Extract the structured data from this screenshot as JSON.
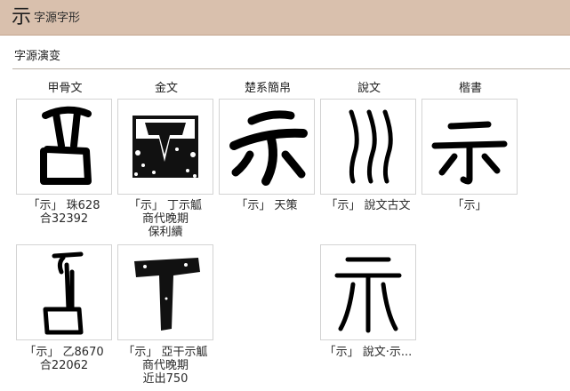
{
  "header": {
    "big_char": "示",
    "title": "字源字形"
  },
  "section": {
    "title": "字源演变"
  },
  "columns": [
    "甲骨文",
    "金文",
    "楚系簡帛",
    "說文",
    "楷書"
  ],
  "glyphs": {
    "jiaguwen_1": {
      "lines": [
        "「示」 珠628",
        "合32392"
      ]
    },
    "jinwen_1": {
      "lines": [
        "「示」 丁示觚",
        "商代晚期",
        "保利續"
      ]
    },
    "chu_1": {
      "lines": [
        "「示」 天策"
      ]
    },
    "shuowen_1": {
      "lines": [
        "「示」 說文古文"
      ]
    },
    "kaishu_1": {
      "lines": [
        "「示」"
      ]
    },
    "jiaguwen_2": {
      "lines": [
        "「示」 乙8670",
        "合22062"
      ]
    },
    "jinwen_2": {
      "lines": [
        "「示」 亞干示觚",
        "商代晚期",
        "近出750"
      ]
    },
    "shuowen_2": {
      "lines": [
        "「示」 說文‧示..."
      ]
    },
    "kaishu_glyph": "示"
  },
  "colors": {
    "header_bg": "#d9c0ad",
    "ink": "#000000",
    "border": "#d3d3d3"
  }
}
